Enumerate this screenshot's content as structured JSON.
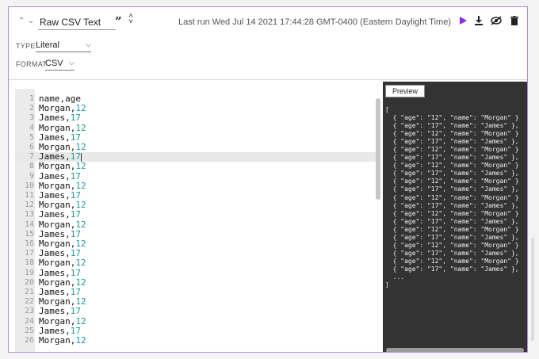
{
  "toolbar": {
    "title_value": "Raw CSV Text",
    "last_run": "Last run Wed Jul 14 2021 17:44:28 GMT-0400 (Eastern Daylight Time)",
    "accent_color": "#8a2be2"
  },
  "settings": {
    "type_label": "TYPE",
    "type_value": "Literal",
    "format_label": "FORMAT",
    "format_value": "CSV"
  },
  "editor": {
    "active_line": 7,
    "lines": [
      {
        "n": "1",
        "name": "name",
        "sep": ",",
        "val": "age"
      },
      {
        "n": "2",
        "name": "Morgan",
        "sep": ",",
        "val": "12"
      },
      {
        "n": "3",
        "name": "James",
        "sep": ",",
        "val": "17"
      },
      {
        "n": "4",
        "name": "Morgan",
        "sep": ",",
        "val": "12"
      },
      {
        "n": "5",
        "name": "James",
        "sep": ",",
        "val": "17"
      },
      {
        "n": "6",
        "name": "Morgan",
        "sep": ",",
        "val": "12"
      },
      {
        "n": "7",
        "name": "James",
        "sep": ",",
        "val": "17"
      },
      {
        "n": "8",
        "name": "Morgan",
        "sep": ",",
        "val": "12"
      },
      {
        "n": "9",
        "name": "James",
        "sep": ",",
        "val": "17"
      },
      {
        "n": "10",
        "name": "Morgan",
        "sep": ",",
        "val": "12"
      },
      {
        "n": "11",
        "name": "James",
        "sep": ",",
        "val": "17"
      },
      {
        "n": "12",
        "name": "Morgan",
        "sep": ",",
        "val": "12"
      },
      {
        "n": "13",
        "name": "James",
        "sep": ",",
        "val": "17"
      },
      {
        "n": "14",
        "name": "Morgan",
        "sep": ",",
        "val": "12"
      },
      {
        "n": "15",
        "name": "James",
        "sep": ",",
        "val": "17"
      },
      {
        "n": "16",
        "name": "Morgan",
        "sep": ",",
        "val": "12"
      },
      {
        "n": "17",
        "name": "James",
        "sep": ",",
        "val": "17"
      },
      {
        "n": "18",
        "name": "Morgan",
        "sep": ",",
        "val": "12"
      },
      {
        "n": "19",
        "name": "James",
        "sep": ",",
        "val": "17"
      },
      {
        "n": "20",
        "name": "Morgan",
        "sep": ",",
        "val": "12"
      },
      {
        "n": "21",
        "name": "James",
        "sep": ",",
        "val": "17"
      },
      {
        "n": "22",
        "name": "Morgan",
        "sep": ",",
        "val": "12"
      },
      {
        "n": "23",
        "name": "James",
        "sep": ",",
        "val": "17"
      },
      {
        "n": "24",
        "name": "Morgan",
        "sep": ",",
        "val": "12"
      },
      {
        "n": "25",
        "name": "James",
        "sep": ",",
        "val": "17"
      },
      {
        "n": "26",
        "name": "Morgan",
        "sep": ",",
        "val": "12"
      }
    ]
  },
  "preview": {
    "tab_label": "Preview",
    "text": "[\n  { \"age\": \"12\", \"name\": \"Morgan\" }\n  { \"age\": \"17\", \"name\": \"James\" },\n  { \"age\": \"12\", \"name\": \"Morgan\" }\n  { \"age\": \"17\", \"name\": \"James\" },\n  { \"age\": \"12\", \"name\": \"Morgan\" }\n  { \"age\": \"17\", \"name\": \"James\" },\n  { \"age\": \"12\", \"name\": \"Morgan\" }\n  { \"age\": \"17\", \"name\": \"James\" },\n  { \"age\": \"12\", \"name\": \"Morgan\" }\n  { \"age\": \"17\", \"name\": \"James\" },\n  { \"age\": \"12\", \"name\": \"Morgan\" }\n  { \"age\": \"17\", \"name\": \"James\" },\n  { \"age\": \"12\", \"name\": \"Morgan\" }\n  { \"age\": \"17\", \"name\": \"James\" },\n  { \"age\": \"12\", \"name\": \"Morgan\" }\n  { \"age\": \"17\", \"name\": \"James\" },\n  { \"age\": \"12\", \"name\": \"Morgan\" }\n  { \"age\": \"17\", \"name\": \"James\" },\n  { \"age\": \"12\", \"name\": \"Morgan\" }\n  { \"age\": \"17\", \"name\": \"James\" },\n  ...\n]"
  }
}
